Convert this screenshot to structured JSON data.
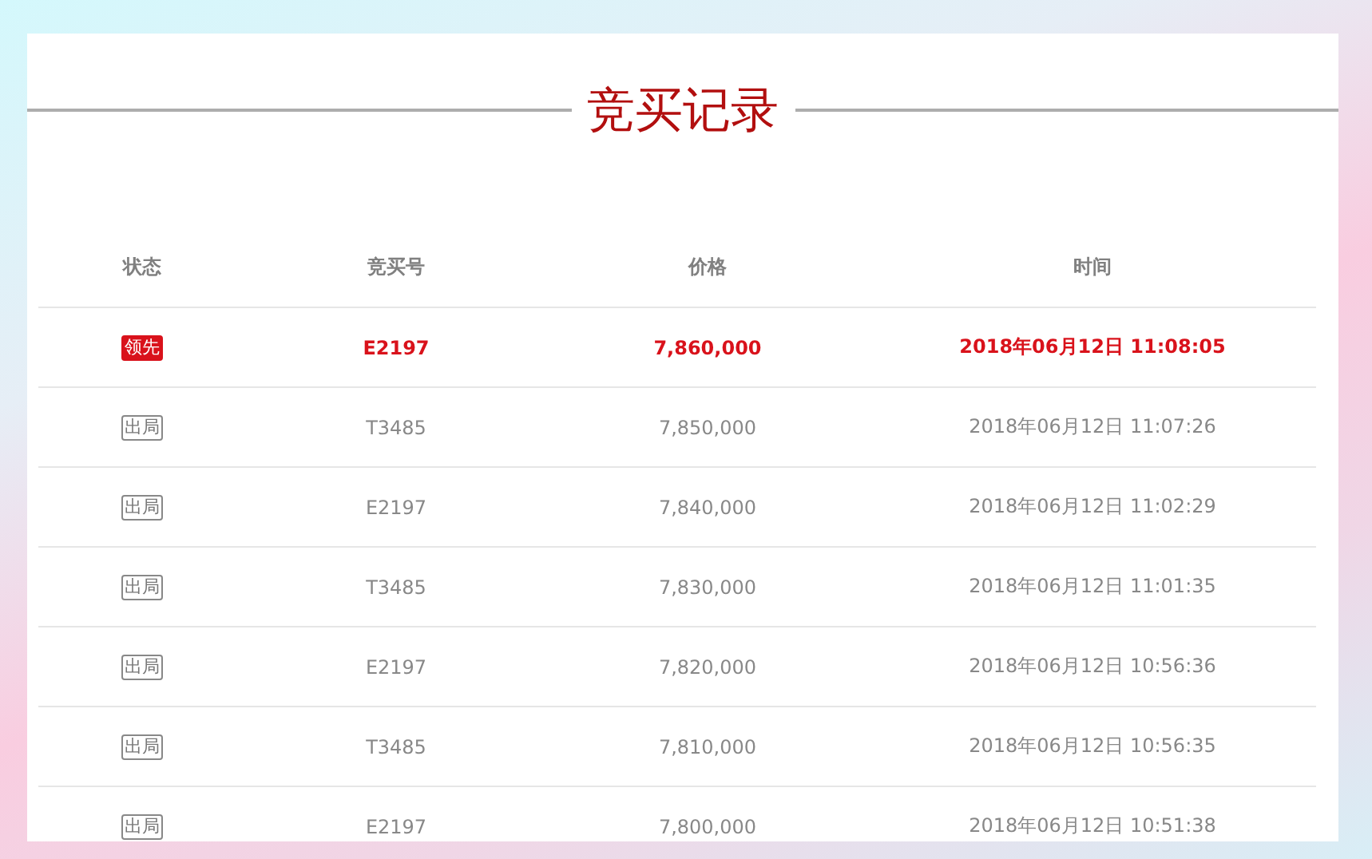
{
  "title": "竞买记录",
  "table": {
    "columns": [
      "状态",
      "竞买号",
      "价格",
      "时间"
    ],
    "rows": [
      {
        "kind": "leading",
        "status": "领先",
        "bidder": "E2197",
        "price": "7,860,000",
        "time": "2018年06月12日 11:08:05"
      },
      {
        "kind": "out",
        "status": "出局",
        "bidder": "T3485",
        "price": "7,850,000",
        "time": "2018年06月12日 11:07:26"
      },
      {
        "kind": "out",
        "status": "出局",
        "bidder": "E2197",
        "price": "7,840,000",
        "time": "2018年06月12日 11:02:29"
      },
      {
        "kind": "out",
        "status": "出局",
        "bidder": "T3485",
        "price": "7,830,000",
        "time": "2018年06月12日 11:01:35"
      },
      {
        "kind": "out",
        "status": "出局",
        "bidder": "E2197",
        "price": "7,820,000",
        "time": "2018年06月12日 10:56:36"
      },
      {
        "kind": "out",
        "status": "出局",
        "bidder": "T3485",
        "price": "7,810,000",
        "time": "2018年06月12日 10:56:35"
      },
      {
        "kind": "out",
        "status": "出局",
        "bidder": "E2197",
        "price": "7,800,000",
        "time": "2018年06月12日 10:51:38"
      }
    ]
  }
}
